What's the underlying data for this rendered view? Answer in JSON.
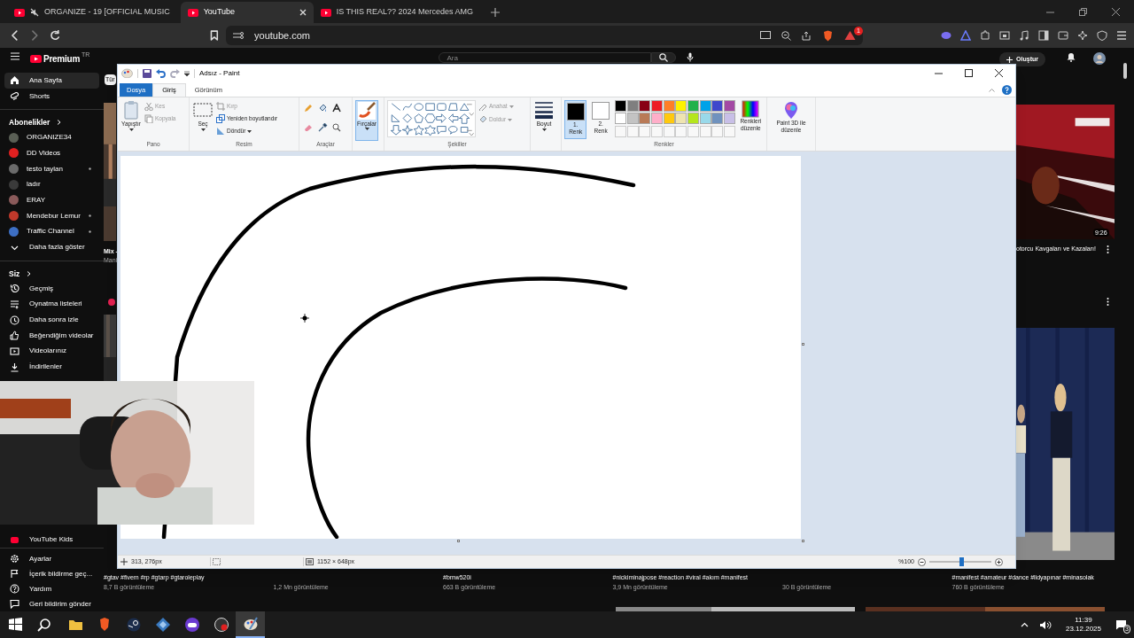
{
  "browser": {
    "tabs": [
      {
        "title": "ORGANIZE - 19 [OFFICIAL MUSIC",
        "selected": false,
        "muted": true
      },
      {
        "title": "YouTube",
        "selected": true,
        "muted": false
      },
      {
        "title": "IS THIS REAL?? 2024 Mercedes AMG",
        "selected": false,
        "muted": false
      }
    ],
    "address": "youtube.com",
    "shield_count": "1"
  },
  "youtube": {
    "logo": "Premium",
    "logo_sup": "TR",
    "search_placeholder": "Ara",
    "create_label": "Oluştur",
    "sidebar": [
      {
        "kind": "item",
        "label": "Ana Sayfa",
        "selected": true
      },
      {
        "kind": "item",
        "label": "Shorts",
        "selected": false
      },
      {
        "kind": "header",
        "label": "Abonelikler"
      },
      {
        "kind": "channel",
        "label": "ORGANIZE34",
        "color": "#5a5f55",
        "new": false
      },
      {
        "kind": "channel",
        "label": "DD Videos",
        "color": "#e02020",
        "new": false
      },
      {
        "kind": "channel",
        "label": "testo taylan",
        "color": "#6b6b6b",
        "new": true
      },
      {
        "kind": "channel",
        "label": "ladır",
        "color": "#3a3a3a",
        "new": false
      },
      {
        "kind": "channel",
        "label": "ERAY",
        "color": "#8a5a5a",
        "new": false
      },
      {
        "kind": "channel",
        "label": "Mendebur Lemur",
        "color": "#c0392b",
        "new": true
      },
      {
        "kind": "channel",
        "label": "Traffic Channel",
        "color": "#3d6fc4",
        "new": true
      },
      {
        "kind": "item",
        "label": "Daha fazla göster",
        "selected": false
      },
      {
        "kind": "header",
        "label": "Siz"
      },
      {
        "kind": "item",
        "label": "Geçmiş",
        "selected": false
      },
      {
        "kind": "item",
        "label": "Oynatma listeleri",
        "selected": false
      },
      {
        "kind": "item",
        "label": "Daha sonra izle",
        "selected": false
      },
      {
        "kind": "item",
        "label": "Beğendiğim videolar",
        "selected": false
      },
      {
        "kind": "item",
        "label": "Videolarınız",
        "selected": false
      },
      {
        "kind": "item",
        "label": "İndirilenler",
        "selected": false
      }
    ],
    "sidebar_bottom": [
      {
        "label": "YouTube Kids"
      },
      {
        "label": "Ayarlar"
      },
      {
        "label": "İçerik bildirme geç..."
      },
      {
        "label": "Yardım"
      },
      {
        "label": "Geri bildirim gönder"
      }
    ],
    "chip": "Tür",
    "left_video": {
      "title": "Mix -",
      "channel": "Mani"
    },
    "right_video": {
      "duration": "9:26",
      "title": "otorcu Kavgaları ve Kazaları!"
    },
    "bottom_videos": [
      {
        "title": "#gtav #fivem #rp #gtarp #gtaroleplay",
        "views": "8,7 B görüntüleme"
      },
      {
        "views": "1,2 Mn görüntüleme"
      },
      {
        "title": "#bmw520i",
        "views": "663 B görüntüleme"
      },
      {
        "title": "#nickiminajpose #reaction #viral #akım #manifest",
        "views": "3,9 Mn görüntüleme"
      },
      {
        "views": "30 B görüntüleme"
      },
      {
        "title": "#manifest #amateur #dance #lidyapınar #minasolak",
        "views": "760 B görüntüleme"
      }
    ]
  },
  "paint": {
    "title": "Adsız - Paint",
    "tabs": [
      {
        "label": "Dosya",
        "kind": "file",
        "selected": false
      },
      {
        "label": "Giriş",
        "kind": "tab",
        "selected": true
      },
      {
        "label": "Görünüm",
        "kind": "tab",
        "selected": false
      }
    ],
    "clipboard": {
      "paste": "Yapıştır",
      "cut": "Kes",
      "copy": "Kopyala",
      "group": "Pano"
    },
    "image": {
      "select": "Seç",
      "crop": "Kırp",
      "resize": "Yeniden boyutlandır",
      "rotate": "Döndür",
      "group": "Resim"
    },
    "tools": {
      "group": "Araçlar"
    },
    "brushes": {
      "label": "Fırçalar",
      "selected": true
    },
    "shapes": {
      "outline": "Anahat",
      "fill": "Doldur",
      "group": "Şekiller"
    },
    "size": "Boyut",
    "colors": {
      "color1": {
        "label": "1. Renk",
        "color": "#000000",
        "selected": true
      },
      "color2": {
        "label": "2. Renk",
        "color": "#ffffff",
        "selected": false
      },
      "palette": [
        {
          "color": "#000000"
        },
        {
          "color": "#7f7f7f"
        },
        {
          "color": "#880015"
        },
        {
          "color": "#ed1c24"
        },
        {
          "color": "#ff7f27"
        },
        {
          "color": "#fff200"
        },
        {
          "color": "#22b14c"
        },
        {
          "color": "#00a2e8"
        },
        {
          "color": "#3f48cc"
        },
        {
          "color": "#a349a4"
        },
        {
          "color": "#ffffff"
        },
        {
          "color": "#c3c3c3"
        },
        {
          "color": "#b97a57"
        },
        {
          "color": "#ffaec9"
        },
        {
          "color": "#ffc90e"
        },
        {
          "color": "#efe4b0"
        },
        {
          "color": "#b5e61d"
        },
        {
          "color": "#99d9ea"
        },
        {
          "color": "#7092be"
        },
        {
          "color": "#c8bfe7"
        }
      ],
      "edit": "Renkleri düzenle",
      "group": "Renkler"
    },
    "paint3d": "Paint 3D ile düzenle",
    "status": {
      "cursor": "313, 276px",
      "size": "1152 × 648px",
      "zoom": "%100",
      "level": 0.52
    }
  },
  "taskbar": {
    "time": "11:39",
    "date": "23.12.2025",
    "notifications": "3"
  }
}
